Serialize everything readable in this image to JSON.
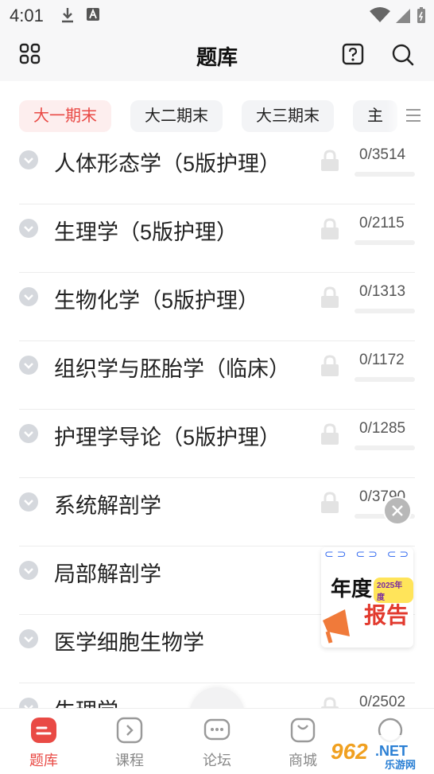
{
  "status": {
    "time": "4:01"
  },
  "header": {
    "title": "题库"
  },
  "tabs": [
    {
      "label": "大一期末",
      "active": true
    },
    {
      "label": "大二期末",
      "active": false
    },
    {
      "label": "大三期末",
      "active": false
    },
    {
      "label": "主",
      "active": false
    }
  ],
  "subjects": [
    {
      "name": "人体形态学（5版护理）",
      "count": "0/3514"
    },
    {
      "name": "生理学（5版护理）",
      "count": "0/2115"
    },
    {
      "name": "生物化学（5版护理）",
      "count": "0/1313"
    },
    {
      "name": "组织学与胚胎学（临床）",
      "count": "0/1172"
    },
    {
      "name": "护理学导论（5版护理）",
      "count": "0/1285"
    },
    {
      "name": "系统解剖学",
      "count": "0/3790"
    },
    {
      "name": "局部解剖学",
      "count": ""
    },
    {
      "name": "医学细胞生物学",
      "count": ""
    },
    {
      "name": "生理学",
      "count": "0/2502"
    }
  ],
  "promo": {
    "line1": "年度",
    "year": "2025年度",
    "line2": "报告"
  },
  "tabbar": {
    "items": [
      {
        "label": "题库",
        "active": true
      },
      {
        "label": "课程",
        "active": false
      },
      {
        "label": "论坛",
        "active": false
      },
      {
        "label": "商城",
        "active": false
      }
    ]
  },
  "watermark": {
    "brand": "962",
    "suffix": ".NET",
    "sub": "乐游网"
  },
  "colors": {
    "accent": "#e94a45",
    "chip_bg": "#f3f4f6",
    "active_chip_bg": "#fdeeee"
  },
  "icons": [
    "grid-icon",
    "help-icon",
    "search-icon",
    "menu-icon",
    "chevron-down-icon",
    "lock-icon",
    "close-icon",
    "question-bank-icon",
    "course-icon",
    "forum-icon",
    "shop-icon"
  ]
}
